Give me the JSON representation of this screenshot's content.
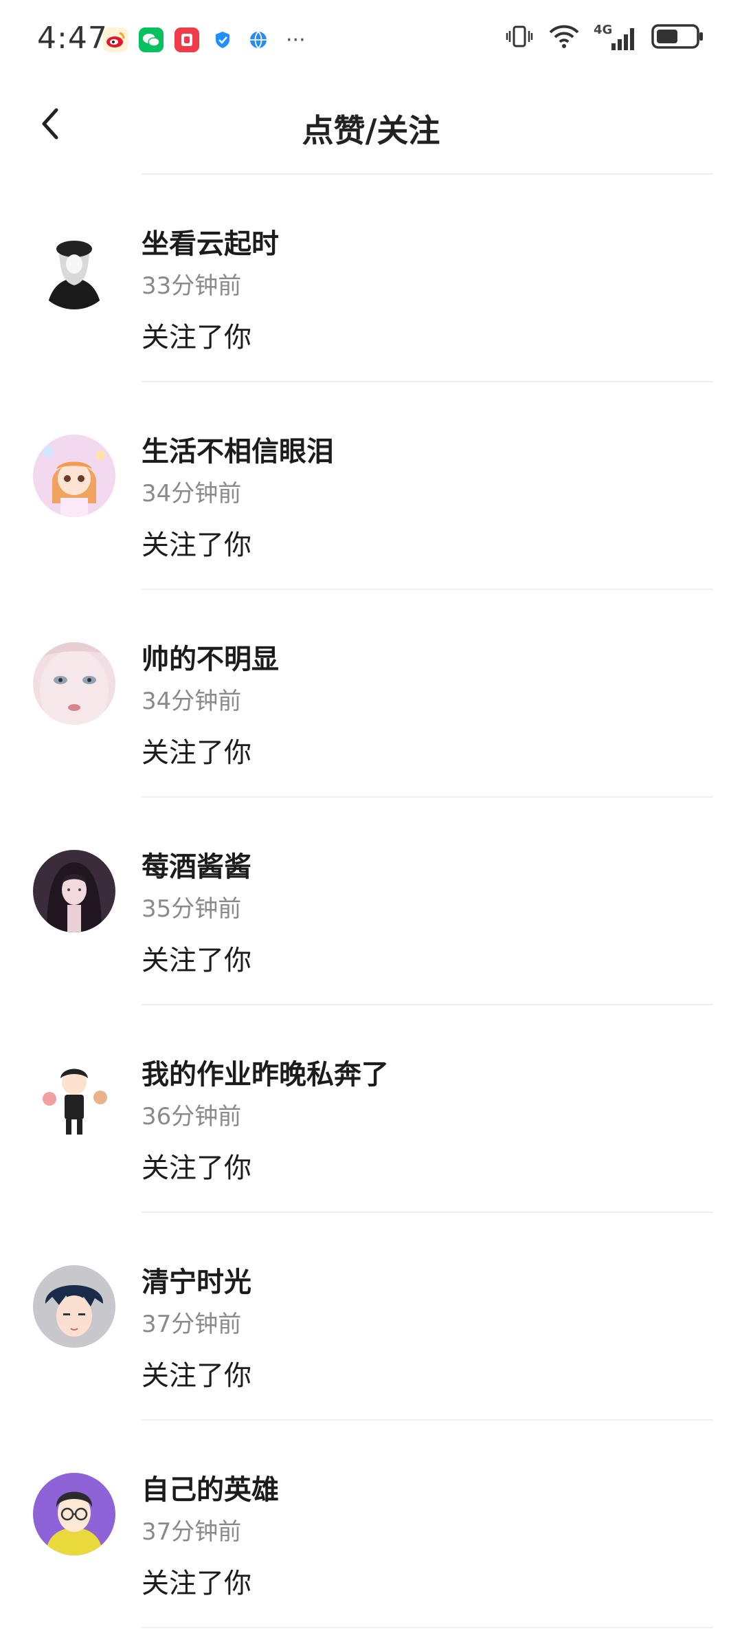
{
  "status_bar": {
    "time": "4:47",
    "network": "4G",
    "icons": [
      "weibo-icon",
      "wechat-icon",
      "red-app-icon",
      "shield-icon",
      "browser-icon",
      "more-icon",
      "vibrate-icon",
      "wifi-icon",
      "signal-icon",
      "battery-icon"
    ],
    "more": "···"
  },
  "header": {
    "title": "点赞/关注",
    "back_icon": "chevron-left-icon"
  },
  "notifications": [
    {
      "name": "坐看云起时",
      "time": "33分钟前",
      "action": "关注了你"
    },
    {
      "name": "生活不相信眼泪",
      "time": "34分钟前",
      "action": "关注了你"
    },
    {
      "name": "帅的不明显",
      "time": "34分钟前",
      "action": "关注了你"
    },
    {
      "name": "莓酒酱酱",
      "time": "35分钟前",
      "action": "关注了你"
    },
    {
      "name": "我的作业昨晚私奔了",
      "time": "36分钟前",
      "action": "关注了你"
    },
    {
      "name": "清宁时光",
      "time": "37分钟前",
      "action": "关注了你"
    },
    {
      "name": "自己的英雄",
      "time": "37分钟前",
      "action": "关注了你"
    }
  ],
  "colors": {
    "divider": "#eeeeee",
    "secondary_text": "#8a8a8a",
    "primary_text": "#1c1c1c"
  }
}
